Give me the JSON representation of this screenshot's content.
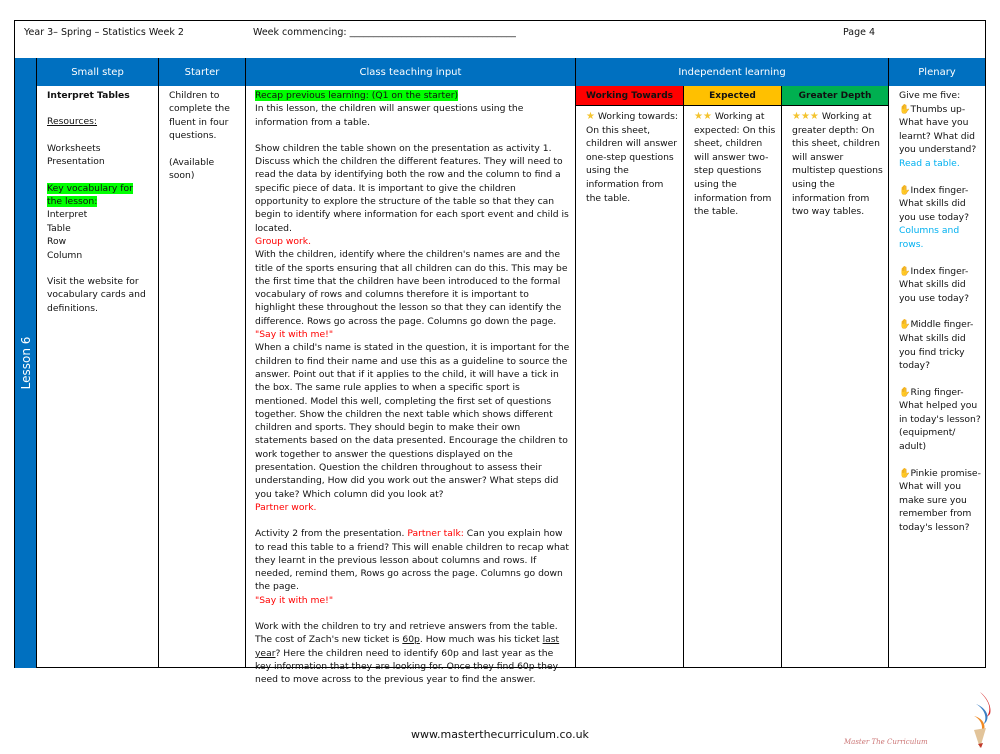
{
  "header": {
    "title": "Year 3– Spring – Statistics Week 2",
    "week_commencing": "Week commencing: ___________________________________",
    "page": "Page 4"
  },
  "columns": {
    "small_step": "Small step",
    "starter": "Starter",
    "teaching": "Class teaching input",
    "independent": "Independent learning",
    "plenary": "Plenary"
  },
  "lesson_label": "Lesson 6",
  "levels": {
    "wt": {
      "label": "Working Towards",
      "color": "#ff0000"
    },
    "exp": {
      "label": "Expected",
      "color": "#ffc000"
    },
    "gd": {
      "label": "Greater Depth",
      "color": "#00b050"
    }
  },
  "small_step": {
    "title": "Interpret Tables",
    "resources_label": "Resources:",
    "resources": [
      "Worksheets",
      "Presentation"
    ],
    "vocab_label_1": "Key vocabulary for",
    "vocab_label_2": "the lesson:",
    "vocab": [
      "Interpret",
      "Table",
      "Row",
      "Column"
    ],
    "website_note": "Visit the website for vocabulary cards and definitions."
  },
  "starter": {
    "text": "Children to complete the fluent in four questions.",
    "note": "(Available soon)"
  },
  "teaching": {
    "recap": "Recap previous learning: (Q1 on the starter)",
    "p1": "In this lesson, the children will answer questions using the information from a table.",
    "p2": "Show children the table shown on the presentation as activity 1. Discuss which the children the different features. They will need to read the data by identifying both the row and the column to find a specific piece of data. It is important to give the children opportunity to explore the structure of the table so that they can begin to identify where information for each sport event and child is located.",
    "group_work": "Group work.",
    "p3": "With the children, identify where the children's names are and the title of the sports ensuring that all children can do this. This may be the first time that the children have been introduced to the formal vocabulary of rows and columns therefore it is important to highlight these throughout the lesson so that they can identify the difference. Rows go across the page. Columns go down the page.",
    "say_it_1": "\"Say it with me!\"",
    "p4": "When a child's name is stated in the question, it is important for the children to find their name and use this as a guideline to source the answer. Point out that if it applies to the child, it will have a tick in the box. The same rule applies to when a specific sport is mentioned. Model this well, completing the first set of questions together. Show the children the next table which shows different children and sports. They should begin to make their own statements based on the data presented. Encourage the children to work together to answer the questions displayed on the presentation. Question the children throughout to assess their understanding, How did you work out the answer? What steps did you take? Which column did you look at?",
    "partner_work": "Partner work.",
    "p5_start": "Activity 2 from the presentation. ",
    "partner_talk": "Partner talk:",
    "p5_rest": " Can you explain how to read this table to a friend? This will enable children to recap what they learnt in the previous lesson about columns and rows. If needed, remind them, Rows go across the page. Columns go down the page.",
    "say_it_2": "\"Say it with me!\"",
    "p6_a": "Work with the children to try and retrieve answers from the table. The cost of Zach's new ticket is ",
    "p6_60p": "60p",
    "p6_b": ". How much was his ticket ",
    "p6_last_year": "last year",
    "p6_c": "? Here the children need to identify 60p and last year as the key information that they are looking for. Once they find 60p they need to move across to the previous year to find the answer."
  },
  "independent": {
    "wt": {
      "stars": "★",
      "text": "Working towards: On this sheet, children will answer one-step questions using the information from the table."
    },
    "exp": {
      "stars": "★★",
      "text": "Working at expected: On this sheet, children will answer two-step questions using the information from the table."
    },
    "gd": {
      "stars": "★★★",
      "text": "Working at greater depth: On this sheet, children will answer multistep questions using the information from two way tables."
    }
  },
  "plenary": {
    "intro": "Give me five:",
    "items": [
      {
        "icon": "hand-icon",
        "text": "Thumbs up- What have you learnt? What did you understand?",
        "answer": "Read a table."
      },
      {
        "icon": "hand-icon",
        "text": "Index finger- What skills did you use today?",
        "answer": "Columns and rows."
      },
      {
        "icon": "hand-icon",
        "text": "Index finger- What skills did you use today?",
        "answer": ""
      },
      {
        "icon": "hand-icon",
        "text": "Middle finger- What skills did you find tricky today?",
        "answer": ""
      },
      {
        "icon": "hand-icon",
        "text": "Ring finger- What helped you in today's lesson? (equipment/ adult)",
        "answer": ""
      },
      {
        "icon": "hand-icon",
        "text": "Pinkie promise- What will you make sure you remember from today's lesson?",
        "answer": ""
      }
    ]
  },
  "footer": {
    "url": "www.masterthecurriculum.co.uk",
    "logo_text": "Master The Curriculum"
  }
}
